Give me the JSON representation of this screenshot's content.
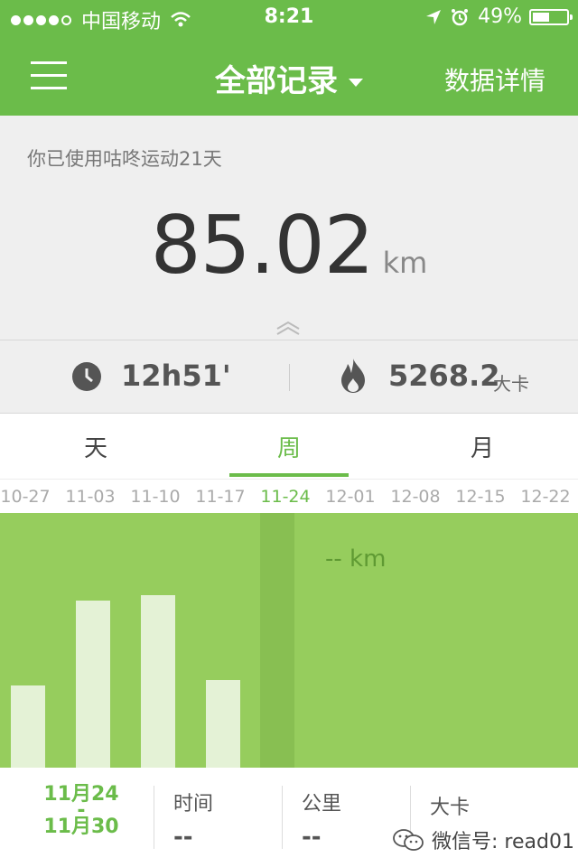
{
  "status_bar": {
    "carrier": "中国移动",
    "time": "8:21",
    "battery": "49%",
    "battery_level": 0.49
  },
  "nav": {
    "title": "全部记录",
    "right_action": "数据详情",
    "menu_icon": "hamburger-icon"
  },
  "summary": {
    "usage_text": "你已使用咕咚运动21天",
    "distance": "85.02",
    "distance_unit": "km"
  },
  "stats": {
    "time": "12h51'",
    "calories": "5268.2",
    "calories_unit": "大卡"
  },
  "tabs": [
    "天",
    "周",
    "月"
  ],
  "active_tab": "周",
  "weeks": [
    "10-27",
    "11-03",
    "11-10",
    "11-17",
    "11-24",
    "12-01",
    "12-08",
    "12-15",
    "12-22"
  ],
  "selected_week": "11-24",
  "chart_data": {
    "type": "bar",
    "categories": [
      "10-27",
      "11-03",
      "11-10",
      "11-17",
      "11-24",
      "12-01",
      "12-08",
      "12-15",
      "12-22"
    ],
    "values": [
      16.5,
      33.5,
      34.5,
      17.5,
      null,
      null,
      null,
      null,
      null
    ],
    "ylim": [
      0,
      51
    ],
    "selected_label": "-- km",
    "colors": {
      "background": "#96cd5d",
      "bar": "#e4f2d6",
      "selected": "#88bf52"
    }
  },
  "footer": {
    "date_start": "11月24",
    "date_sep": "-",
    "date_end": "11月30",
    "time_label": "时间",
    "time_value": "--",
    "distance_label": "公里",
    "distance_value": "--",
    "calories_label": "大卡",
    "watermark": "微信号: read01"
  },
  "colors": {
    "accent": "#6bbc4a"
  }
}
